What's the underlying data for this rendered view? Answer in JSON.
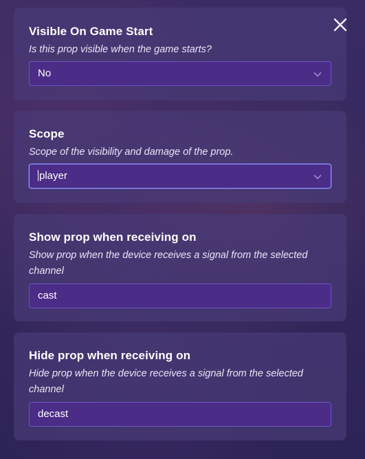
{
  "close_icon": "close-icon",
  "panels": [
    {
      "title": "Visible On Game Start",
      "description": "Is this prop visible when the game starts?",
      "control": "select",
      "value": "No"
    },
    {
      "title": "Scope",
      "description": "Scope of the visibility and damage of the prop.",
      "control": "select",
      "value": "player"
    },
    {
      "title": "Show prop when receiving on",
      "description_line1": "Show prop when the device receives a signal from the selected",
      "description_line2": "channel",
      "control": "text",
      "value": "cast"
    },
    {
      "title": "Hide prop when receiving on",
      "description_line1": "Hide prop when the device receives a signal from the selected",
      "description_line2": "channel",
      "control": "text",
      "value": "decast"
    }
  ],
  "colors": {
    "panel_bg": "#483a76",
    "field_bg": "#4b2c87",
    "field_border": "#6e55c2",
    "focus_border": "#8f9bff"
  }
}
